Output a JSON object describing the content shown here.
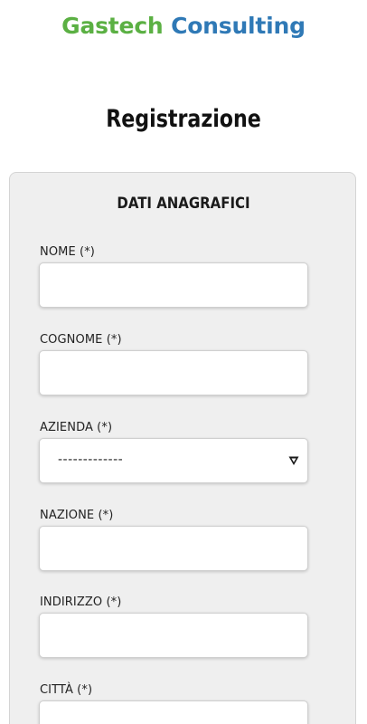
{
  "header": {
    "brand_part1": "Gastech",
    "brand_part2": "Consulting",
    "colors": {
      "brand_green": "#5bb043",
      "brand_blue": "#2f79b6"
    }
  },
  "page": {
    "title": "Registrazione"
  },
  "form": {
    "section_title": "DATI ANAGRAFICI",
    "fields": [
      {
        "label": "NOME (*)",
        "value": "",
        "type": "text"
      },
      {
        "label": "COGNOME (*)",
        "value": "",
        "type": "text"
      },
      {
        "label": "AZIENDA (*)",
        "selected": "-------------",
        "type": "select",
        "icon": "chevron-down-icon"
      },
      {
        "label": "NAZIONE (*)",
        "value": "",
        "type": "text"
      },
      {
        "label": "INDIRIZZO (*)",
        "value": "",
        "type": "text"
      },
      {
        "label": "CITTÀ (*)",
        "value": "",
        "type": "text"
      }
    ]
  }
}
